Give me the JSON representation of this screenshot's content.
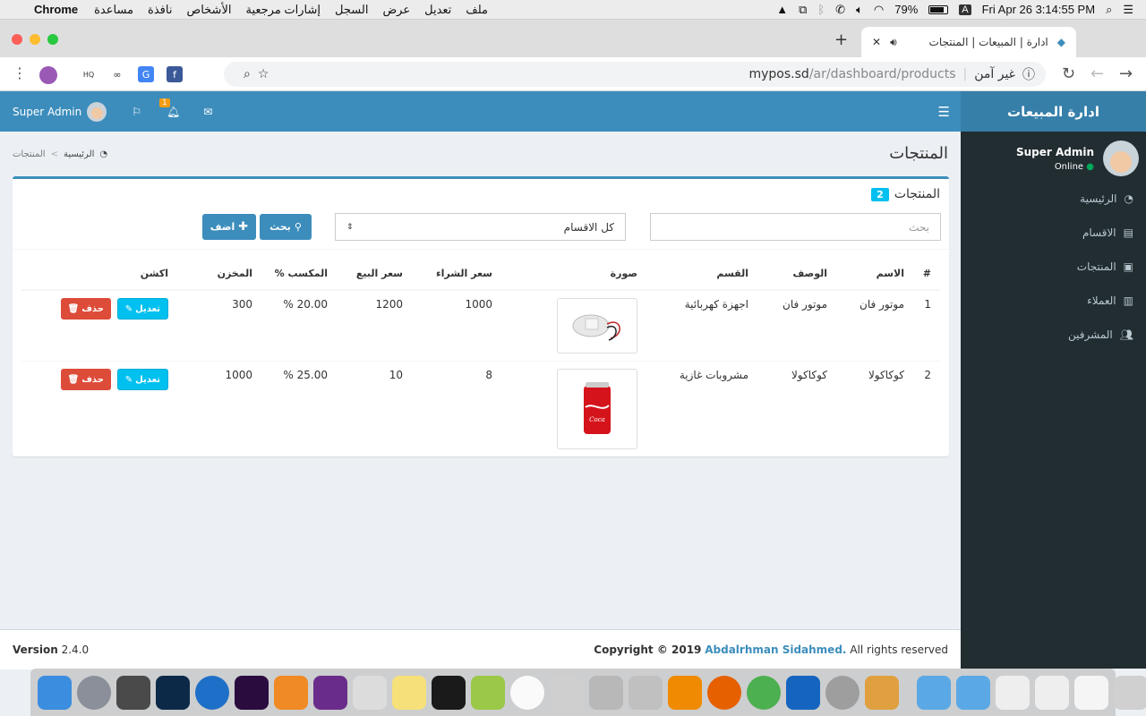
{
  "menubar": {
    "app": "Chrome",
    "menus": [
      "ملف",
      "تعديل",
      "عرض",
      "السجل",
      "إشارات مرجعية",
      "الأشخاص",
      "نافذة",
      "مساعدة"
    ],
    "battery": "79%",
    "input_source": "A",
    "datetime": "Fri Apr 26  3:14:55 PM"
  },
  "browser": {
    "tab_title": "ادارة | المبيعات | المنتجات",
    "not_secure": "غير آمن",
    "url_host": "mypos.sd",
    "url_path": "/ar/dashboard/products"
  },
  "app": {
    "brand": "ادارة المبيعات",
    "user_name": "Super Admin",
    "user_status": "Online",
    "notification_count": "1",
    "sidebar": [
      "الرئيسية",
      "الاقسام",
      "المنتجات",
      "العملاء",
      "المشرفين"
    ],
    "page_title": "المنتجات",
    "breadcrumb_home": "الرئيسية",
    "breadcrumb_sep": ">",
    "breadcrumb_current": "المنتجات",
    "box_title": "المنتجات",
    "box_count": "2",
    "search_placeholder": "بحث",
    "category_select": "كل الاقسام",
    "search_button": "بحث",
    "add_button": "اضف",
    "table_headers": [
      "#",
      "الاسم",
      "الوصف",
      "القسم",
      "صورة",
      "سعر الشراء",
      "سعر البيع",
      "المكسب %",
      "المخزن",
      "اكشن"
    ],
    "rows": [
      {
        "num": "1",
        "name": "موتور فان",
        "desc": "موتور فان",
        "category": "اجهزة كهربائية",
        "image": "motor",
        "buy": "1000",
        "sell": "1200",
        "profit": "20.00 %",
        "stock": "300"
      },
      {
        "num": "2",
        "name": "كوكاكولا",
        "desc": "كوكاكولا",
        "category": "مشروبات غازية",
        "image": "coca-cola-can",
        "buy": "8",
        "sell": "10",
        "profit": "25.00 %",
        "stock": "1000"
      }
    ],
    "edit_label": "تعديل",
    "delete_label": "حذف",
    "footer_copyright_prefix": "Copyright © 2019",
    "footer_author": "Abdalrhman Sidahmed.",
    "footer_rights": "All rights reserved",
    "footer_version_label": "Version",
    "footer_version": "2.4.0"
  },
  "colors": {
    "header": "#3c8dbc",
    "brand": "#367fa9",
    "sidebar": "#222d32",
    "edit": "#00c0ef",
    "delete": "#dd4b39"
  }
}
